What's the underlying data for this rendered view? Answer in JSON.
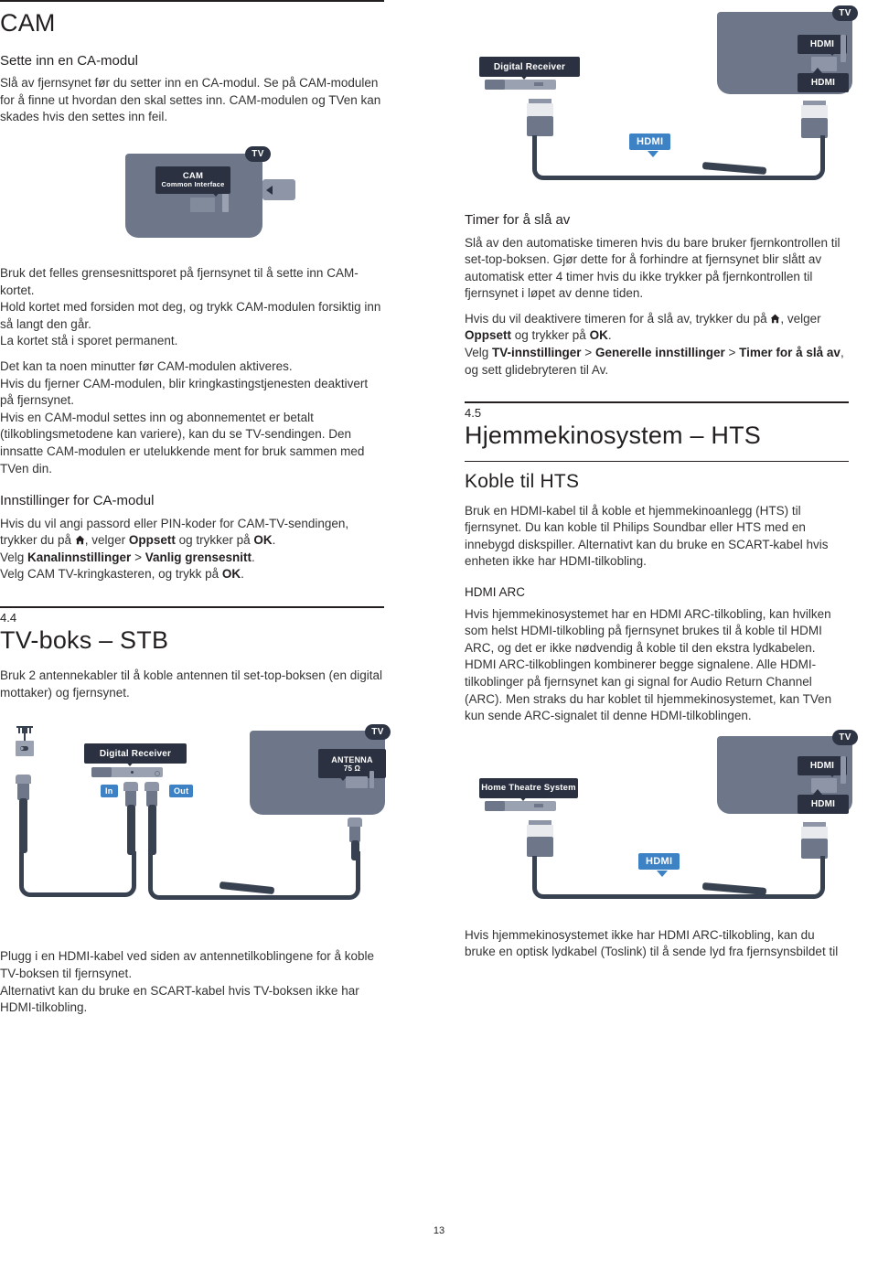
{
  "page": {
    "number": "13"
  },
  "left_column": {
    "chapter_title": "CAM",
    "sections": [
      {
        "subhead": "Sette inn en CA-modul",
        "paragraphs": [
          "Slå av fjernsynet før du setter inn en CA-modul. Se på CAM-modulen for å finne ut hvordan den skal settes inn. CAM-modulen og TVen kan skades hvis den settes inn feil."
        ]
      }
    ],
    "after_diagram": {
      "para1_line1": "Bruk det felles grensesnittsporet på fjernsynet til å sette inn CAM-kortet.",
      "para1_line2": "Hold kortet med forsiden mot deg, og trykk CAM-modulen forsiktig inn så langt den går.",
      "para1_line3": "La kortet stå i sporet permanent.",
      "para2_line1": "Det kan ta noen minutter før CAM-modulen aktiveres.",
      "para2_line2": "Hvis du fjerner CAM-modulen, blir kringkastingstjenesten deaktivert på fjernsynet.",
      "para2_line3": "Hvis en CAM-modul settes inn og abonnementet er betalt (tilkoblingsmetodene kan variere), kan du se TV-sendingen. Den innsatte CAM-modulen er utelukkende ment for bruk sammen med TVen din."
    },
    "ca_settings": {
      "subhead": "Innstillinger for CA-modul",
      "line1_a": "Hvis du vil angi passord eller PIN-koder for CAM-TV-sendingen, trykker du på ",
      "line1_b": ", velger ",
      "line1_bold1": "Oppsett",
      "line1_c": " og trykker på ",
      "line1_bold2": "OK",
      "line1_d": ".",
      "line2_a": "Velg ",
      "line2_bold1": "Kanalinnstillinger",
      "line2_b": " > ",
      "line2_bold2": "Vanlig grensesnitt",
      "line2_c": ".",
      "line3_a": "Velg CAM TV-kringkasteren, og trykk på ",
      "line3_bold1": "OK",
      "line3_b": "."
    },
    "section_44": {
      "number": "4.4",
      "title": "TV-boks – STB",
      "intro": "Bruk 2 antennekabler til å koble antennen til set-top-boksen (en digital mottaker) og fjernsynet."
    },
    "after_stb_diagram": {
      "line1": "Plugg i en HDMI-kabel ved siden av antennetilkoblingene for å koble TV-boksen til fjernsynet.",
      "line2": "Alternativt kan du bruke en SCART-kabel hvis TV-boksen ikke har HDMI-tilkobling."
    }
  },
  "right_column": {
    "timer": {
      "subhead": "Timer for å slå av",
      "para1": "Slå av den automatiske timeren hvis du bare bruker fjernkontrollen til set-top-boksen. Gjør dette for å forhindre at fjernsynet blir slått av automatisk etter 4 timer hvis du ikke trykker på fjernkontrollen til fjernsynet i løpet av denne tiden.",
      "para2_a": "Hvis du vil deaktivere timeren for å slå av, trykker du på ",
      "para2_b": ", velger ",
      "para2_bold1": "Oppsett",
      "para2_c": " og trykker på ",
      "para2_bold2": "OK",
      "para2_d": ".",
      "para3_a": "Velg ",
      "para3_bold1": "TV-innstillinger",
      "para3_b": " > ",
      "para3_bold2": "Generelle innstillinger",
      "para3_c": " > ",
      "para3_bold3": "Timer for å slå av",
      "para3_d": ", og sett glidebryteren til Av."
    },
    "section_45": {
      "number": "4.5",
      "title": "Hjemmekinosystem – HTS",
      "subhead": "Koble til HTS",
      "intro": "Bruk en HDMI-kabel til å koble et hjemmekinoanlegg (HTS) til fjernsynet. Du kan koble til Philips Soundbar eller HTS med en innebygd diskspiller. Alternativt kan du bruke en SCART-kabel hvis enheten ikke har HDMI-tilkobling."
    },
    "hdmi_arc": {
      "minihead": "HDMI ARC",
      "para": "Hvis hjemmekinosystemet har en HDMI ARC-tilkobling, kan hvilken som helst HDMI-tilkobling på fjernsynet brukes til å koble til HDMI ARC, og det er ikke nødvendig å koble til den ekstra lydkabelen. HDMI ARC-tilkoblingen kombinerer begge signalene. Alle HDMI-tilkoblinger på fjernsynet kan gi signal for Audio Return Channel (ARC). Men straks du har koblet til hjemmekinosystemet, kan TVen kun sende ARC-signalet til denne HDMI-tilkoblingen."
    },
    "after_hts_diagram": {
      "para": "Hvis hjemmekinosystemet ikke har HDMI ARC-tilkobling, kan du bruke en optisk lydkabel (Toslink) til å sende lyd fra fjernsynsbildet til"
    }
  },
  "diagrams": {
    "cam": {
      "tv_badge": "TV",
      "tag_title": "CAM",
      "tag_sub": "Common Interface"
    },
    "digital_receiver_hdmi": {
      "tv_badge": "TV",
      "device_label": "Digital Receiver",
      "tv_port_top": "HDMI",
      "tv_port_bottom": "HDMI",
      "cable_label": "HDMI"
    },
    "antenna_stb": {
      "tv_badge": "TV",
      "device_label": "Digital Receiver",
      "port_in": "In",
      "port_out": "Out",
      "tv_port": "ANTENNA",
      "tv_port_sub": "75 Ω"
    },
    "hts_hdmi": {
      "tv_badge": "TV",
      "device_label": "Home Theatre System",
      "tv_port_top": "HDMI",
      "tv_port_bottom": "HDMI",
      "cable_label": "HDMI"
    }
  },
  "colors": {
    "accent_blue": "#3d82c4",
    "panel_gray": "#6d7789",
    "tag_dark": "#2b3140",
    "cable_dark": "#37414f",
    "text": "#231f20"
  }
}
